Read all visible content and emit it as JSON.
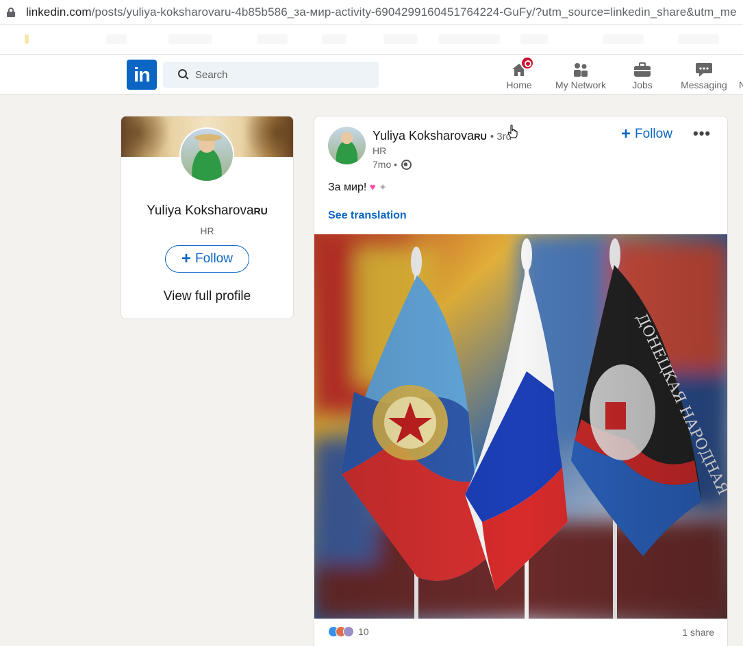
{
  "browser": {
    "url_host": "linkedin.com",
    "url_path": "/posts/yuliya-koksharovaru-4b85b586_за-мир-activity-6904299160451764224-GuFy/?utm_source=linkedin_share&utm_me"
  },
  "nav": {
    "search_placeholder": "Search",
    "items": [
      {
        "label": "Home",
        "icon": "home-icon"
      },
      {
        "label": "My Network",
        "icon": "network-icon"
      },
      {
        "label": "Jobs",
        "icon": "briefcase-icon"
      },
      {
        "label": "Messaging",
        "icon": "messaging-icon"
      },
      {
        "label": "N",
        "icon": ""
      }
    ]
  },
  "profile": {
    "name": "Yuliya Koksharova",
    "name_suffix": "RU",
    "headline": "HR",
    "follow_label": "Follow",
    "view_profile_label": "View full profile"
  },
  "post": {
    "author_name": "Yuliya Koksharova",
    "author_suffix": "RU",
    "degree": "• 3rd",
    "headline": "HR",
    "age": "7mo •",
    "follow_label": "Follow",
    "text": "За мир!",
    "see_translation": "See translation",
    "reaction_count": "10",
    "shares": "1 share"
  },
  "colors": {
    "linkedin_blue": "#0a66c2",
    "notification_red": "#cb112d",
    "background": "#f3f2ef"
  }
}
